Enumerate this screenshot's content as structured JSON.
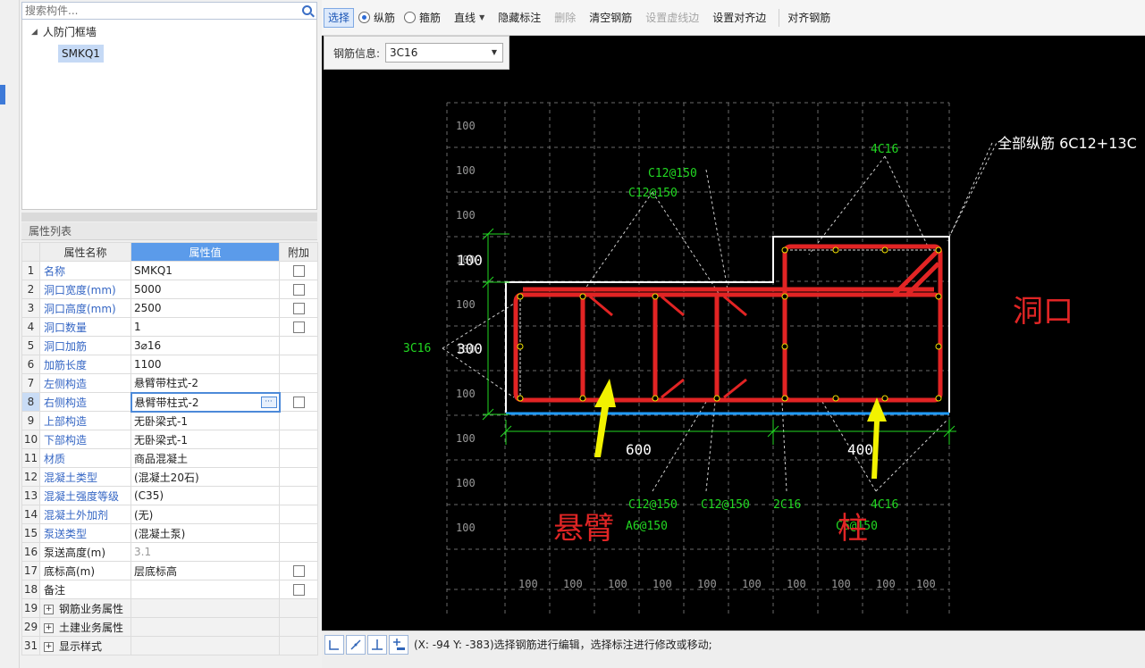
{
  "search": {
    "placeholder": "搜索构件..."
  },
  "tree": {
    "root": "人防门框墙",
    "child": "SMKQ1"
  },
  "props": {
    "title": "属性列表",
    "headers": {
      "name": "属性名称",
      "value": "属性值",
      "extra": "附加"
    },
    "rows": [
      {
        "num": "1",
        "name": "名称",
        "value": "SMKQ1"
      },
      {
        "num": "2",
        "name": "洞口宽度(mm)",
        "value": "5000"
      },
      {
        "num": "3",
        "name": "洞口高度(mm)",
        "value": "2500"
      },
      {
        "num": "4",
        "name": "洞口数量",
        "value": "1"
      },
      {
        "num": "5",
        "name": "洞口加筋",
        "value": "3⌀16"
      },
      {
        "num": "6",
        "name": "加筋长度",
        "value": "1100"
      },
      {
        "num": "7",
        "name": "左侧构造",
        "value": "悬臂带柱式-2"
      },
      {
        "num": "8",
        "name": "右侧构造",
        "value": "悬臂带柱式-2"
      },
      {
        "num": "9",
        "name": "上部构造",
        "value": "无卧梁式-1"
      },
      {
        "num": "10",
        "name": "下部构造",
        "value": "无卧梁式-1"
      },
      {
        "num": "11",
        "name": "材质",
        "value": "商品混凝土"
      },
      {
        "num": "12",
        "name": "混凝土类型",
        "value": "(混凝土20石)"
      },
      {
        "num": "13",
        "name": "混凝土强度等级",
        "value": "(C35)"
      },
      {
        "num": "14",
        "name": "混凝土外加剂",
        "value": "(无)"
      },
      {
        "num": "15",
        "name": "泵送类型",
        "value": "(混凝土泵)"
      },
      {
        "num": "16",
        "name": "泵送高度(m)",
        "value": "3.1"
      },
      {
        "num": "17",
        "name": "底标高(m)",
        "value": "层底标高"
      },
      {
        "num": "18",
        "name": "备注",
        "value": ""
      },
      {
        "num": "19",
        "name": "钢筋业务属性",
        "value": ""
      },
      {
        "num": "29",
        "name": "土建业务属性",
        "value": ""
      },
      {
        "num": "31",
        "name": "显示样式",
        "value": ""
      }
    ]
  },
  "toolbar": {
    "select": "选择",
    "longitudinal": "纵筋",
    "stirrup": "箍筋",
    "straight": "直线",
    "hide_labels": "隐藏标注",
    "delete": "删除",
    "clear_rebar": "清空钢筋",
    "set_dashed_edge": "设置虚线边",
    "set_align_edge": "设置对齐边",
    "align_rebar": "对齐钢筋"
  },
  "rebar_info": {
    "label": "钢筋信息:",
    "value": "3C16"
  },
  "drawing": {
    "grid_label": "100",
    "dim_100": "100",
    "dim_300": "300",
    "dim_600": "600",
    "dim_400": "400",
    "label_3c16": "3C16",
    "label_c12_a": "C12@150",
    "label_c12_b": "C12@150",
    "label_4c16_top": "4C16",
    "label_all_long": "全部纵筋 6C12+13C",
    "label_c12_c": "C12@150",
    "label_c12_d": "C12@150",
    "label_2c16": "2C16",
    "label_4c16_bot": "4C16",
    "label_a6": "A6@150",
    "label_c6": "C6@150",
    "note_opening": "洞口",
    "note_cantilever": "悬臂",
    "note_column": "柱"
  },
  "status": {
    "text": "(X: -94 Y: -383)选择钢筋进行编辑，选择标注进行修改或移动;"
  }
}
